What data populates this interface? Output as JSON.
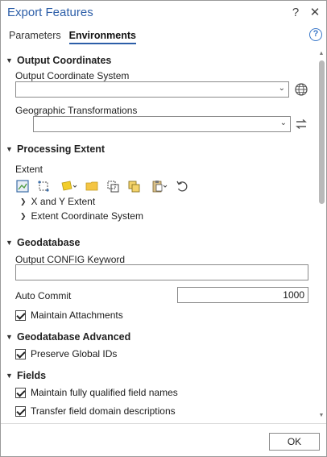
{
  "window": {
    "title": "Export Features",
    "help_btn": "?",
    "close_btn": "✕"
  },
  "tabs": [
    {
      "label": "Parameters",
      "active": false
    },
    {
      "label": "Environments",
      "active": true
    }
  ],
  "help_icon": "?",
  "sections": {
    "output_coordinates": {
      "title": "Output Coordinates",
      "output_cs_label": "Output Coordinate System",
      "output_cs_value": "",
      "geo_transform_label": "Geographic Transformations",
      "geo_transform_value": ""
    },
    "processing_extent": {
      "title": "Processing Extent",
      "extent_label": "Extent",
      "tree_items": [
        "X and Y Extent",
        "Extent Coordinate System"
      ]
    },
    "geodatabase": {
      "title": "Geodatabase",
      "config_label": "Output CONFIG Keyword",
      "config_value": "",
      "auto_commit_label": "Auto Commit",
      "auto_commit_value": "1000",
      "maintain_attachments_label": "Maintain Attachments",
      "maintain_attachments_checked": true
    },
    "geodatabase_advanced": {
      "title": "Geodatabase Advanced",
      "preserve_ids_label": "Preserve Global IDs",
      "preserve_ids_checked": true
    },
    "fields": {
      "title": "Fields",
      "qualified_names_label": "Maintain fully qualified field names",
      "qualified_names_checked": true,
      "domain_desc_label": "Transfer field domain descriptions",
      "domain_desc_checked": true
    }
  },
  "footer": {
    "ok_label": "OK"
  },
  "colors": {
    "accent": "#2c5ea8",
    "help": "#3a78c9"
  }
}
